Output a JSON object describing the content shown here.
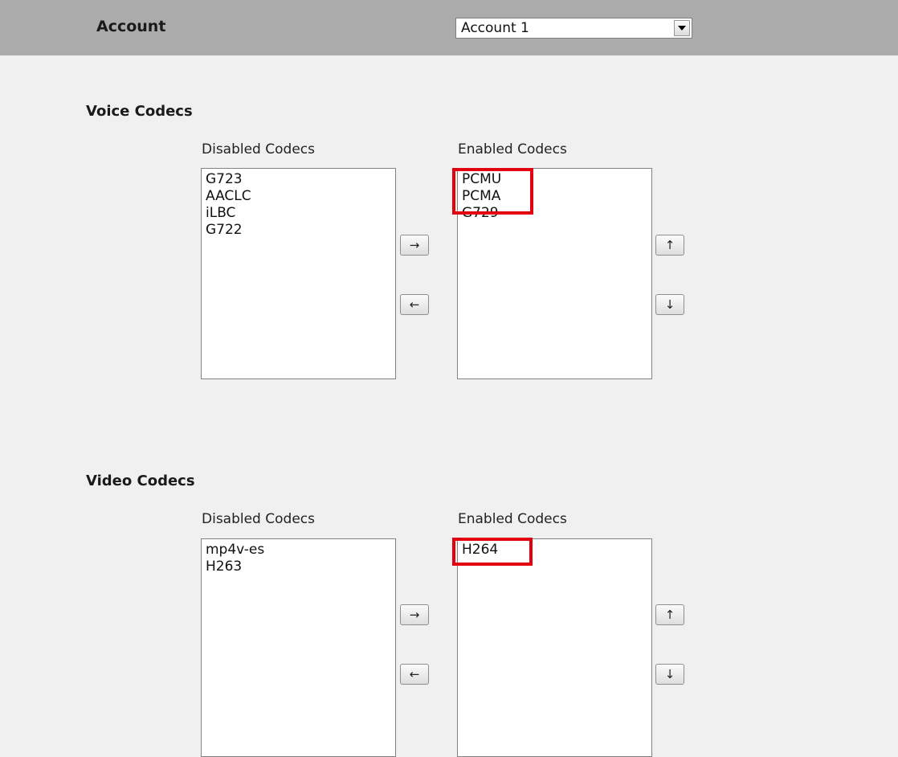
{
  "header": {
    "account_label": "Account",
    "account_select": {
      "selected": "Account 1"
    }
  },
  "voice": {
    "title": "Voice Codecs",
    "disabled_label": "Disabled Codecs",
    "enabled_label": "Enabled Codecs",
    "disabled_items": [
      "G723",
      "AACLC",
      "iLBC",
      "G722"
    ],
    "enabled_items": [
      "PCMU",
      "PCMA",
      "G729"
    ]
  },
  "video": {
    "title": "Video Codecs",
    "disabled_label": "Disabled Codecs",
    "enabled_label": "Enabled Codecs",
    "disabled_items": [
      "mp4v-es",
      "H263"
    ],
    "enabled_items": [
      "H264"
    ]
  },
  "buttons": {
    "move_right": "→",
    "move_left": "←",
    "move_up": "↑",
    "move_down": "↓"
  },
  "colors": {
    "header_bar": "#ababab",
    "highlight_box": "#e3000f"
  }
}
